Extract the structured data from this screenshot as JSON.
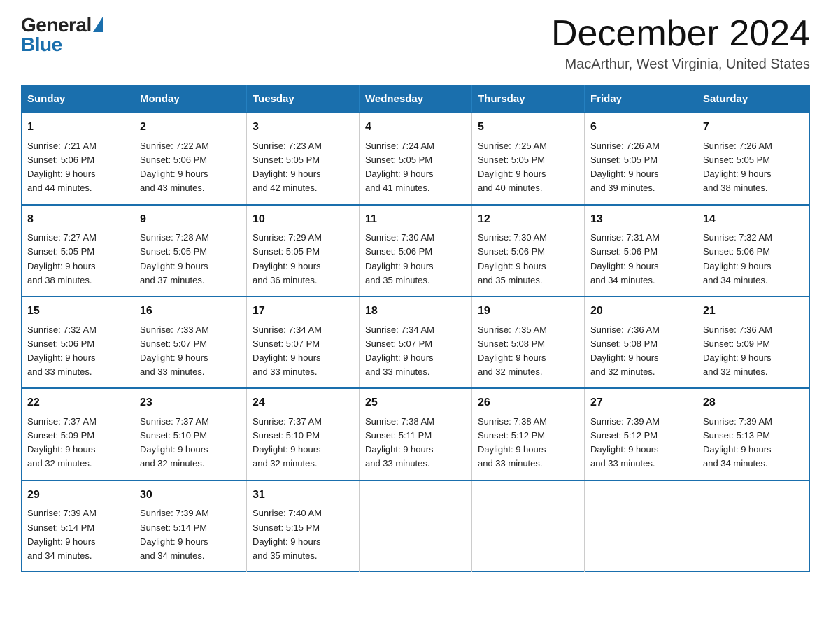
{
  "header": {
    "logo_general": "General",
    "logo_blue": "Blue",
    "month_title": "December 2024",
    "location": "MacArthur, West Virginia, United States"
  },
  "days_of_week": [
    "Sunday",
    "Monday",
    "Tuesday",
    "Wednesday",
    "Thursday",
    "Friday",
    "Saturday"
  ],
  "weeks": [
    [
      {
        "day": "1",
        "sunrise": "7:21 AM",
        "sunset": "5:06 PM",
        "daylight": "9 hours and 44 minutes."
      },
      {
        "day": "2",
        "sunrise": "7:22 AM",
        "sunset": "5:06 PM",
        "daylight": "9 hours and 43 minutes."
      },
      {
        "day": "3",
        "sunrise": "7:23 AM",
        "sunset": "5:05 PM",
        "daylight": "9 hours and 42 minutes."
      },
      {
        "day": "4",
        "sunrise": "7:24 AM",
        "sunset": "5:05 PM",
        "daylight": "9 hours and 41 minutes."
      },
      {
        "day": "5",
        "sunrise": "7:25 AM",
        "sunset": "5:05 PM",
        "daylight": "9 hours and 40 minutes."
      },
      {
        "day": "6",
        "sunrise": "7:26 AM",
        "sunset": "5:05 PM",
        "daylight": "9 hours and 39 minutes."
      },
      {
        "day": "7",
        "sunrise": "7:26 AM",
        "sunset": "5:05 PM",
        "daylight": "9 hours and 38 minutes."
      }
    ],
    [
      {
        "day": "8",
        "sunrise": "7:27 AM",
        "sunset": "5:05 PM",
        "daylight": "9 hours and 38 minutes."
      },
      {
        "day": "9",
        "sunrise": "7:28 AM",
        "sunset": "5:05 PM",
        "daylight": "9 hours and 37 minutes."
      },
      {
        "day": "10",
        "sunrise": "7:29 AM",
        "sunset": "5:05 PM",
        "daylight": "9 hours and 36 minutes."
      },
      {
        "day": "11",
        "sunrise": "7:30 AM",
        "sunset": "5:06 PM",
        "daylight": "9 hours and 35 minutes."
      },
      {
        "day": "12",
        "sunrise": "7:30 AM",
        "sunset": "5:06 PM",
        "daylight": "9 hours and 35 minutes."
      },
      {
        "day": "13",
        "sunrise": "7:31 AM",
        "sunset": "5:06 PM",
        "daylight": "9 hours and 34 minutes."
      },
      {
        "day": "14",
        "sunrise": "7:32 AM",
        "sunset": "5:06 PM",
        "daylight": "9 hours and 34 minutes."
      }
    ],
    [
      {
        "day": "15",
        "sunrise": "7:32 AM",
        "sunset": "5:06 PM",
        "daylight": "9 hours and 33 minutes."
      },
      {
        "day": "16",
        "sunrise": "7:33 AM",
        "sunset": "5:07 PM",
        "daylight": "9 hours and 33 minutes."
      },
      {
        "day": "17",
        "sunrise": "7:34 AM",
        "sunset": "5:07 PM",
        "daylight": "9 hours and 33 minutes."
      },
      {
        "day": "18",
        "sunrise": "7:34 AM",
        "sunset": "5:07 PM",
        "daylight": "9 hours and 33 minutes."
      },
      {
        "day": "19",
        "sunrise": "7:35 AM",
        "sunset": "5:08 PM",
        "daylight": "9 hours and 32 minutes."
      },
      {
        "day": "20",
        "sunrise": "7:36 AM",
        "sunset": "5:08 PM",
        "daylight": "9 hours and 32 minutes."
      },
      {
        "day": "21",
        "sunrise": "7:36 AM",
        "sunset": "5:09 PM",
        "daylight": "9 hours and 32 minutes."
      }
    ],
    [
      {
        "day": "22",
        "sunrise": "7:37 AM",
        "sunset": "5:09 PM",
        "daylight": "9 hours and 32 minutes."
      },
      {
        "day": "23",
        "sunrise": "7:37 AM",
        "sunset": "5:10 PM",
        "daylight": "9 hours and 32 minutes."
      },
      {
        "day": "24",
        "sunrise": "7:37 AM",
        "sunset": "5:10 PM",
        "daylight": "9 hours and 32 minutes."
      },
      {
        "day": "25",
        "sunrise": "7:38 AM",
        "sunset": "5:11 PM",
        "daylight": "9 hours and 33 minutes."
      },
      {
        "day": "26",
        "sunrise": "7:38 AM",
        "sunset": "5:12 PM",
        "daylight": "9 hours and 33 minutes."
      },
      {
        "day": "27",
        "sunrise": "7:39 AM",
        "sunset": "5:12 PM",
        "daylight": "9 hours and 33 minutes."
      },
      {
        "day": "28",
        "sunrise": "7:39 AM",
        "sunset": "5:13 PM",
        "daylight": "9 hours and 34 minutes."
      }
    ],
    [
      {
        "day": "29",
        "sunrise": "7:39 AM",
        "sunset": "5:14 PM",
        "daylight": "9 hours and 34 minutes."
      },
      {
        "day": "30",
        "sunrise": "7:39 AM",
        "sunset": "5:14 PM",
        "daylight": "9 hours and 34 minutes."
      },
      {
        "day": "31",
        "sunrise": "7:40 AM",
        "sunset": "5:15 PM",
        "daylight": "9 hours and 35 minutes."
      },
      null,
      null,
      null,
      null
    ]
  ],
  "labels": {
    "sunrise_prefix": "Sunrise: ",
    "sunset_prefix": "Sunset: ",
    "daylight_prefix": "Daylight: "
  }
}
